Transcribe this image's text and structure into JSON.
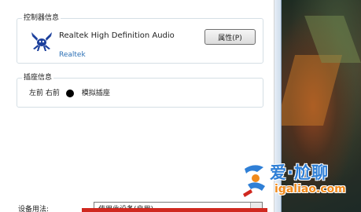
{
  "controller": {
    "group_title": "控制器信息",
    "device_name": "Realtek High Definition Audio",
    "vendor": "Realtek",
    "properties_button": "属性(P)",
    "logo_icon": "realtek-crab-icon"
  },
  "jack": {
    "group_title": "插座信息",
    "position": "左前 右前",
    "type": "模拟插座",
    "dot_color": "#000000"
  },
  "usage": {
    "label": "设备用法:",
    "selected": "使用此设备(启用)"
  },
  "watermark": {
    "line1": "爱·尬聊",
    "line2": "igaliao.com",
    "brand_color": "#2f7fd6",
    "accent_color": "#f08a1c"
  },
  "colors": {
    "highlight_bar": "#d0281f",
    "link": "#2a6fb5"
  }
}
